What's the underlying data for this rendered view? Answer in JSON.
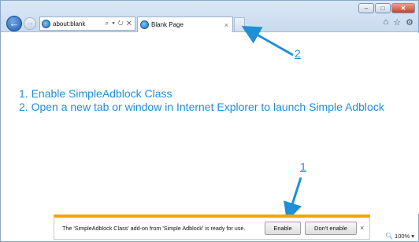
{
  "browser": {
    "address": "about:blank",
    "address_controls": "⌕ ▾ ↻ ✕",
    "tab_title": "Blank Page",
    "tab_close": "×",
    "caption": {
      "minimize": "–",
      "maximize": "□",
      "close": "✕"
    },
    "tools": {
      "home": "⌂",
      "favorites": "☆",
      "settings": "⚙"
    },
    "back": "←",
    "forward": "→"
  },
  "instructions": {
    "step1": "1. Enable SimpleAdblock Class",
    "step2": "2. Open a new tab or window in Internet Explorer to launch Simple Adblock"
  },
  "callouts": {
    "label_1": "1",
    "label_2": "2"
  },
  "notification": {
    "message": "The 'SimpleAdblock Class' add-on from 'Simple Adblock' is ready for use.",
    "enable_label": "Enable",
    "dont_enable_label": "Don't enable",
    "close": "×"
  },
  "status": {
    "zoom": "100%",
    "zoom_caret": "▾"
  },
  "colors": {
    "accent": "#1f8fd8",
    "notification_bar": "#f5a300"
  }
}
